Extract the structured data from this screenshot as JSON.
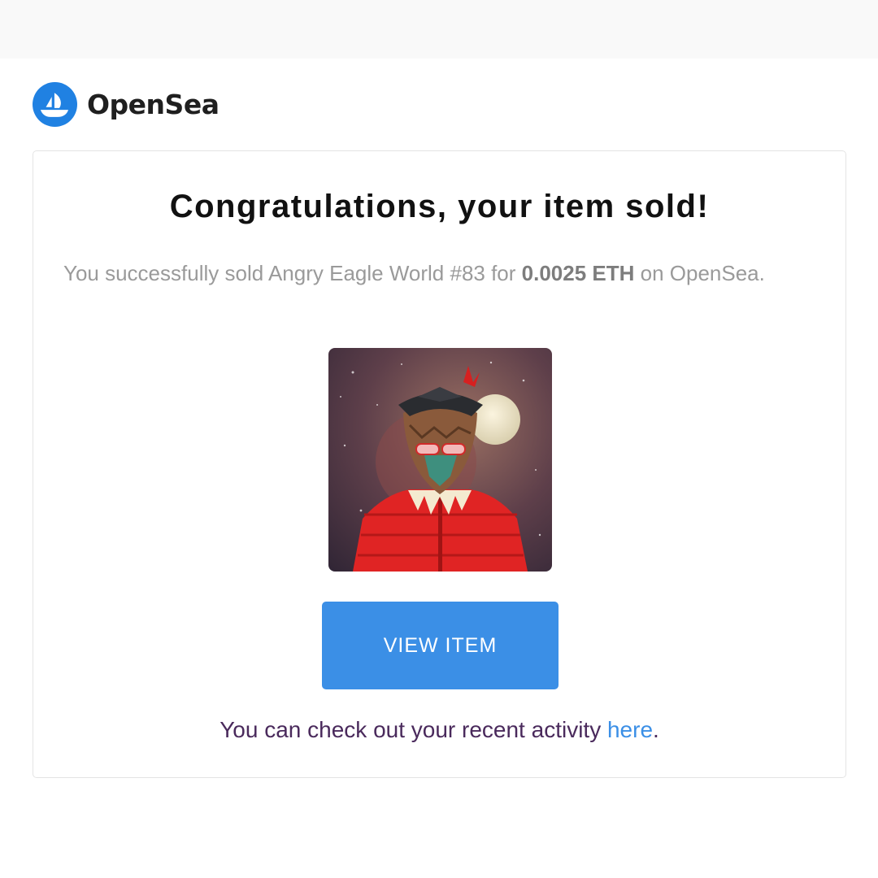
{
  "brand": {
    "name": "OpenSea",
    "logo_icon": "opensea-boat-logo",
    "color": "#2081e2"
  },
  "email": {
    "headline": "Congratulations, your item sold!",
    "message": {
      "prefix": "You successfully sold Angry Eagle World #83 for ",
      "price": "0.0025 ETH",
      "suffix": " on OpenSea."
    },
    "item_image": {
      "description_icon": "angry-eagle-nft-artwork"
    },
    "button": {
      "label": "VIEW ITEM",
      "color": "#3b8fe6"
    },
    "footer": {
      "text": "You can check out your recent activity ",
      "link_label": "here",
      "end": "."
    }
  }
}
